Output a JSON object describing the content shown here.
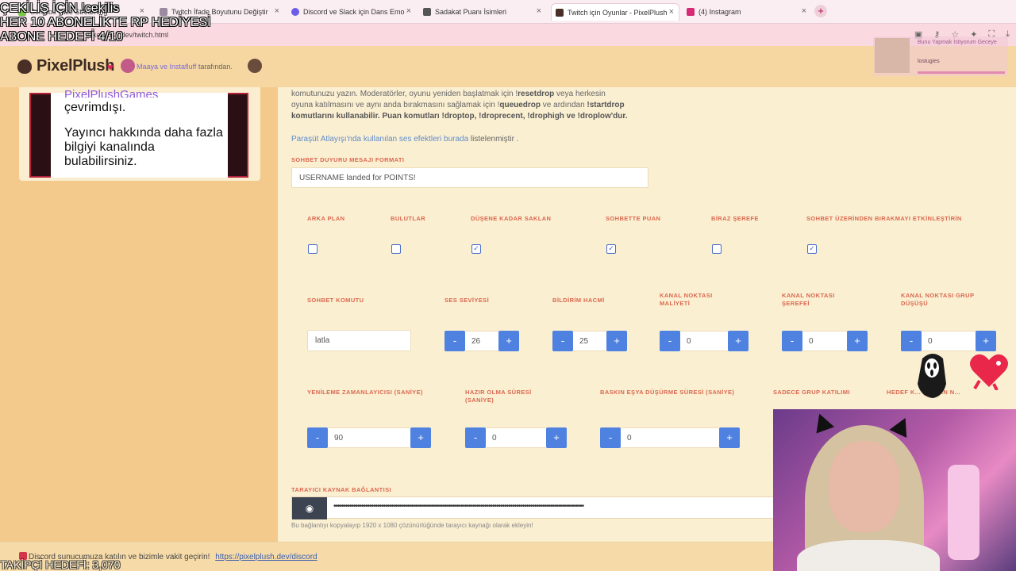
{
  "overlay": {
    "line1": "ÇEKİLİŞ İÇİN !cekilis",
    "line2": "HER 10 ABONELİKTE RP HEDİYESİ",
    "line3": "ABONE HEDEFİ 4/10",
    "bottom": "TAKİPÇİ HEDEFİ: 3,070"
  },
  "browser": {
    "tabs": [
      {
        "title": "Sonidos Tace Streaming",
        "favicon_color": "#7ac943"
      },
      {
        "title": "Twitch İfade Boyutunu Değiştir",
        "favicon_color": "#9b8aa0"
      },
      {
        "title": "Discord ve Slack için Dans Emo",
        "favicon_color": "#6c5ce7"
      },
      {
        "title": "Sadakat Puanı İsimleri",
        "favicon_color": "#555555"
      },
      {
        "title": "Twitch için Oyunlar - PixelPlush",
        "favicon_color": "#4a2f26",
        "active": true
      },
      {
        "title": "(4) Instagram",
        "favicon_color": "#d62976"
      }
    ],
    "url": "pixelplush.dev/twitch.html"
  },
  "header": {
    "logo": "PixelPlush",
    "credit_names": "Maaya ve Instafluff",
    "credit_suffix": "tarafından."
  },
  "sidebar": {
    "channel_name": "PixelPlushGames",
    "status": "çevrimdışı.",
    "description": "Yayıncı hakkında daha fazla bilgiyi kanalında bulabilirsiniz."
  },
  "main": {
    "intro_1": "komutunuzu yazın. Moderatörler, oyunu yeniden başlatmak için !",
    "intro_1b": "resetdrop",
    "intro_1c": " veya herkesin",
    "intro_2": "oyuna katılmasını ve aynı anda bırakmasını sağlamak için !",
    "intro_2b": "queuedrop",
    "intro_2c": " ve ardından ",
    "intro_2d": "!startdrop",
    "intro_3": "komutlarını kullanabilir. Puan komutları !droptop, !droprecent, !drophigh ve !droplow'dur.",
    "sound_text_a": "Paraşüt Atlayışı'nda kullanılan ses efektleri burada",
    "sound_text_b": " listelenmiştir .",
    "chat_announce_label": "SOHBET DUYURU MESAJI FORMATI",
    "chat_announce_value": "USERNAME landed for POINTS!",
    "checkboxes": [
      {
        "label": "ARKA PLAN",
        "checked": false
      },
      {
        "label": "BULUTLAR",
        "checked": false
      },
      {
        "label": "DÜŞENE KADAR SAKLAN",
        "checked": true
      },
      {
        "label": "SOHBETTE PUAN",
        "checked": true
      },
      {
        "label": "BİRAZ ŞEREFE",
        "checked": false
      },
      {
        "label": "SOHBET ÜZERİNDEN BIRAKMAYI ETKİNLEŞTİRİN",
        "checked": true
      }
    ],
    "row2": {
      "chat_command_label": "SOHBET KOMUTU",
      "chat_command_value": "latla",
      "volume_label": "SES SEVİYESİ",
      "volume_value": "26",
      "notif_label": "BİLDİRİM HACMİ",
      "notif_value": "25",
      "cp_cost_label": "KANAL NOKTASI MALİYETİ",
      "cp_cost_value": "0",
      "cp_honor_label": "KANAL NOKTASI ŞEREFEİ",
      "cp_honor_value": "0",
      "cp_group_label": "KANAL NOKTASI GRUP DÜŞÜŞÜ",
      "cp_group_value": "0"
    },
    "row3": {
      "refresh_label": "YENİLEME ZAMANLAYICISI (SANİYE)",
      "refresh_value": "90",
      "ready_label": "HAZIR OLMA SÜRESİ (SANİYE)",
      "ready_value": "0",
      "raid_label": "BASKIN EŞYA DÜŞÜRME SÜRESİ (SANİYE)",
      "raid_value": "0",
      "group_only_label": "SADECE GRUP KATILIMI",
      "target_label": "HEDEF K... (EKRAN N..."
    },
    "minus": "-",
    "plus": "+",
    "source_label": "TARAYICI KAYNAK BAĞLANTISI",
    "source_hint": "Bu bağlantıyı kopyalayıp 1920 x 1080 çözünürlüğünde tarayıcı kaynağı olarak ekleyin!"
  },
  "footer": {
    "text": "Discord sunucumuza katılın ve bizimle vakit geçirin!",
    "link": "https://pixelplush.dev/discord"
  },
  "widget": {
    "line1": "Bunu Yapmak İstiyorum Geceye",
    "line2": "lostugies"
  }
}
